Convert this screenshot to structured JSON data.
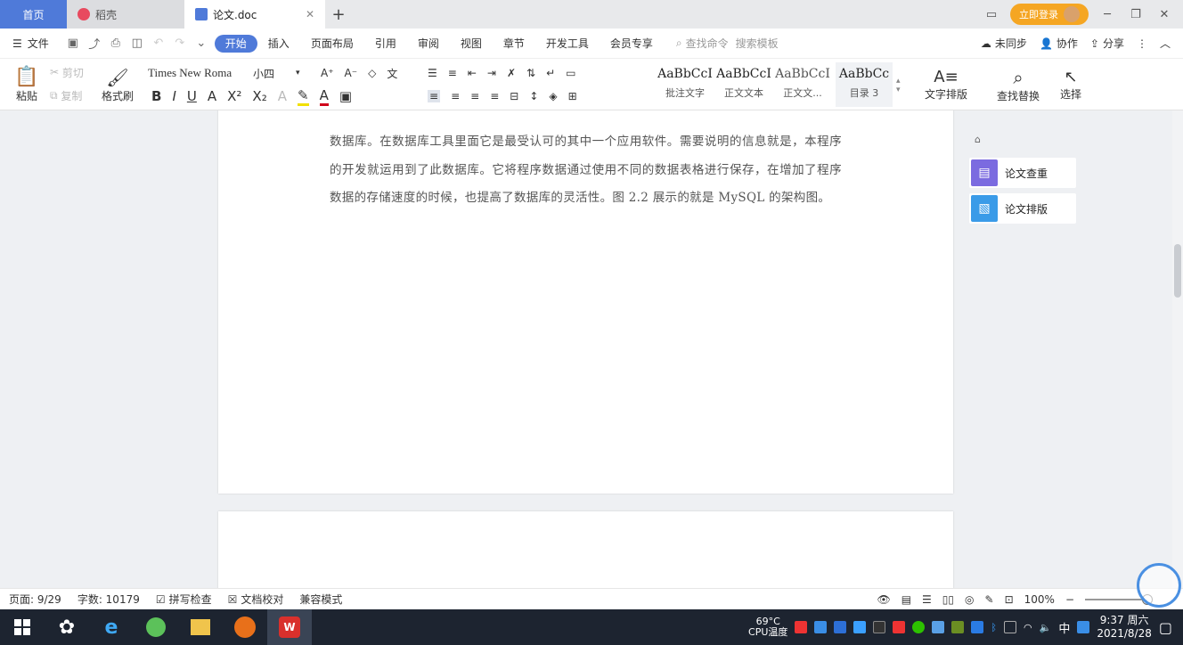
{
  "tabs": {
    "home": "首页",
    "daoke": "稻壳",
    "doc": "论文.doc",
    "new_tab": "+"
  },
  "titlebar": {
    "login": "立即登录"
  },
  "menubar": {
    "file": "文件",
    "items": [
      "开始",
      "插入",
      "页面布局",
      "引用",
      "审阅",
      "视图",
      "章节",
      "开发工具",
      "会员专享"
    ],
    "search_cmd": "查找命令",
    "search_tpl": "搜索模板",
    "sync": "未同步",
    "collab": "协作",
    "share": "分享"
  },
  "ribbon": {
    "paste": "粘贴",
    "cut": "剪切",
    "copy": "复制",
    "format_painter": "格式刷",
    "font_name": "Times New Roma",
    "font_size": "小四",
    "styles": [
      {
        "sample": "AaBbCcI",
        "name": "批注文字"
      },
      {
        "sample": "AaBbCcI",
        "name": "正文文本"
      },
      {
        "sample": "AaBbCcI",
        "name": "正文文..."
      },
      {
        "sample": "AaBbCc",
        "name": "目录 3"
      }
    ],
    "text_layout": "文字排版",
    "find_replace": "查找替换",
    "select": "选择"
  },
  "document": {
    "paragraph": "数据库。在数据库工具里面它是最受认可的其中一个应用软件。需要说明的信息就是，本程序的开发就运用到了此数据库。它将程序数据通过使用不同的数据表格进行保存，在增加了程序数据的存储速度的时候，也提高了数据库的灵活性。图 2.2 展示的就是 MySQL 的架构图。"
  },
  "side_panel": {
    "check": "论文查重",
    "layout": "论文排版"
  },
  "statusbar": {
    "page": "页面: 9/29",
    "words": "字数: 10179",
    "spell": "拼写检查",
    "proof": "文档校对",
    "compat": "兼容模式",
    "zoom": "100%"
  },
  "taskbar": {
    "cpu_temp": "69°C",
    "cpu_label": "CPU温度",
    "ime": "中",
    "time": "9:37 周六",
    "date": "2021/8/28"
  },
  "colors": {
    "accent": "#4f7ad9",
    "taskbar": "#1d2430",
    "login": "#f5a623"
  }
}
